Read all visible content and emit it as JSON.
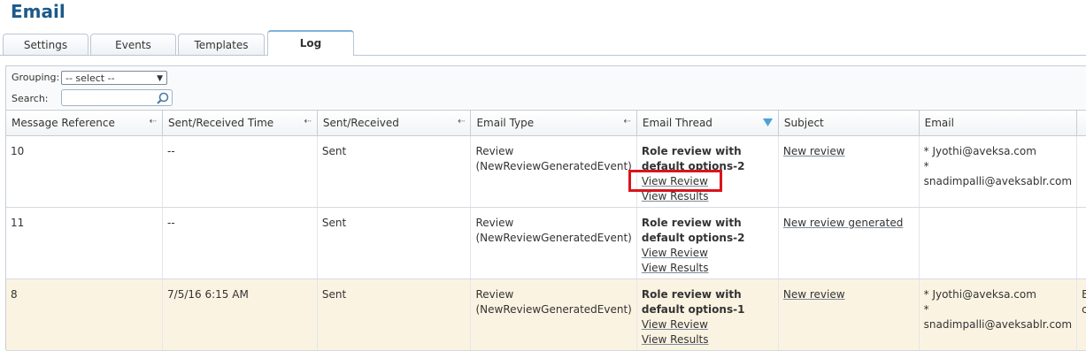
{
  "page": {
    "title": "Email"
  },
  "tabs": [
    {
      "label": "Settings"
    },
    {
      "label": "Events"
    },
    {
      "label": "Templates"
    },
    {
      "label": "Log",
      "active": true
    }
  ],
  "toolbar": {
    "grouping_label": "Grouping:",
    "grouping_value": "-- select --",
    "search_label": "Search:",
    "search_value": ""
  },
  "table": {
    "columns": [
      "Message Reference",
      "Sent/Received Time",
      "Sent/Received",
      "Email Type",
      "Email Thread",
      "Subject",
      "Email",
      ""
    ],
    "rows": [
      {
        "ref": "10",
        "time": "--",
        "sent": "Sent",
        "type_1": "Review",
        "type_2": "(NewReviewGeneratedEvent)",
        "thread_title": "Role review with default options-2",
        "view_review": "View Review",
        "view_results": "View Results",
        "subject": "New review",
        "email_1": "* Jyothi@aveksa.com",
        "email_2": "* snadimpalli@aveksablr.com",
        "extra": ""
      },
      {
        "ref": "11",
        "time": "--",
        "sent": "Sent",
        "type_1": "Review",
        "type_2": "(NewReviewGeneratedEvent)",
        "thread_title": "Role review with default options-2",
        "view_review": "View Review",
        "view_results": "View Results",
        "subject": "New review generated",
        "email_1": "",
        "email_2": "",
        "extra": ""
      },
      {
        "ref": "8",
        "time": "7/5/16 6:15 AM",
        "sent": "Sent",
        "type_1": "Review",
        "type_2": "(NewReviewGeneratedEvent)",
        "thread_title": "Role review with default options-1",
        "view_review": "View Review",
        "view_results": "View Results",
        "subject": "New review",
        "email_1": "* Jyothi@aveksa.com",
        "email_2": "* snadimpalli@aveksablr.com",
        "extra": "E c"
      }
    ]
  },
  "colors": {
    "title": "#1c5a8a",
    "highlight_row": "#fbf3e2",
    "annotation": "#d9141d"
  }
}
